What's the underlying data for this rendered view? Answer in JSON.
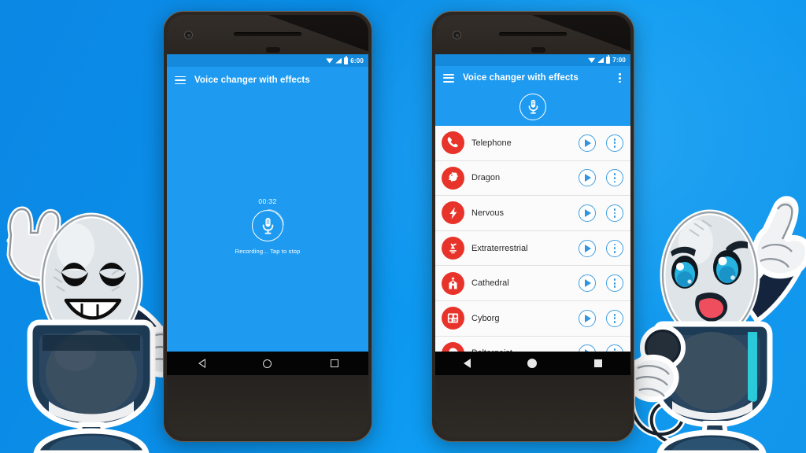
{
  "background": {
    "accent": "#0b8ee8",
    "gradient_from": "#0b87e4",
    "gradient_to": "#1296ec"
  },
  "theme": {
    "app_blue": "#1e9bf0",
    "statusbar_blue": "#1589db",
    "icon_red": "#e8332a",
    "button_blue": "#2f95e0"
  },
  "phone_left": {
    "status": {
      "time": "6:00",
      "wifi_icon": "wifi-icon",
      "signal_icon": "signal-icon",
      "battery_icon": "battery-icon"
    },
    "appbar": {
      "menu_icon": "hamburger-menu-icon",
      "title": "Voice changer with effects"
    },
    "recorder": {
      "timer": "00:32",
      "mic_icon": "microphone-icon",
      "hint": "Recording... Tap to stop"
    },
    "navbar": {
      "back": "back-icon",
      "home": "home-icon",
      "recents": "recents-icon"
    }
  },
  "phone_right": {
    "status": {
      "time": "7:00",
      "wifi_icon": "wifi-icon",
      "signal_icon": "signal-icon",
      "battery_icon": "battery-icon"
    },
    "appbar": {
      "menu_icon": "hamburger-menu-icon",
      "title": "Voice changer with effects",
      "overflow_icon": "overflow-menu-icon"
    },
    "record_button": {
      "mic_icon": "microphone-icon"
    },
    "effects": [
      {
        "label": "Telephone",
        "icon": "telephone-icon",
        "play": "play-icon",
        "menu": "overflow-menu-icon"
      },
      {
        "label": "Dragon",
        "icon": "dragon-icon",
        "play": "play-icon",
        "menu": "overflow-menu-icon"
      },
      {
        "label": "Nervous",
        "icon": "lightning-bolt-icon",
        "play": "play-icon",
        "menu": "overflow-menu-icon"
      },
      {
        "label": "Extraterrestrial",
        "icon": "alien-icon",
        "play": "play-icon",
        "menu": "overflow-menu-icon"
      },
      {
        "label": "Cathedral",
        "icon": "church-icon",
        "play": "play-icon",
        "menu": "overflow-menu-icon"
      },
      {
        "label": "Cyborg",
        "icon": "robot-face-icon",
        "play": "play-icon",
        "menu": "overflow-menu-icon"
      },
      {
        "label": "Poltergeist",
        "icon": "ghost-icon",
        "play": "play-icon",
        "menu": "overflow-menu-icon"
      }
    ],
    "navbar": {
      "back": "back-icon",
      "home": "home-icon",
      "recents": "recents-icon"
    }
  },
  "mascots": {
    "left": {
      "name": "happy-microphone-mascot",
      "expression": "smiling-peace-sign"
    },
    "right": {
      "name": "confident-microphone-mascot",
      "expression": "pointing-up-holding-mic"
    }
  }
}
